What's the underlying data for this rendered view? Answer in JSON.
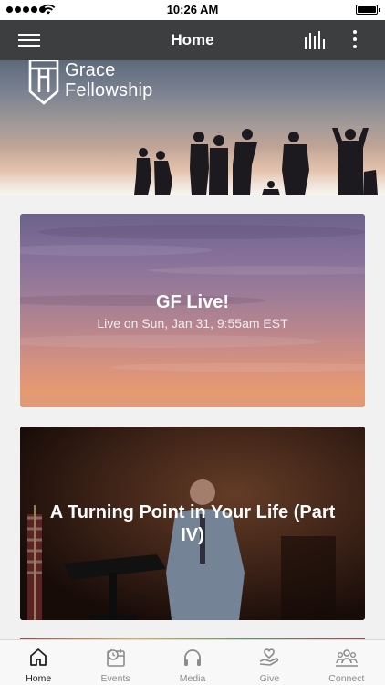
{
  "status_bar": {
    "time": "10:26 AM"
  },
  "header": {
    "title": "Home",
    "menu_icon": "hamburger-menu-icon",
    "audio_icon": "audio-bars-icon",
    "more_icon": "vertical-ellipsis-icon"
  },
  "hero": {
    "logo_line1": "Grace",
    "logo_line2": "Fellowship"
  },
  "feed": {
    "cards": [
      {
        "title": "GF Live!",
        "subtitle": "Live on Sun, Jan 31, 9:55am EST"
      },
      {
        "title": "A Turning Point in Your Life (Part IV)"
      }
    ]
  },
  "tabs": [
    {
      "label": "Home",
      "icon": "home-icon",
      "active": true
    },
    {
      "label": "Events",
      "icon": "calendar-clock-icon",
      "active": false
    },
    {
      "label": "Media",
      "icon": "headphones-icon",
      "active": false
    },
    {
      "label": "Give",
      "icon": "give-heart-hand-icon",
      "active": false
    },
    {
      "label": "Connect",
      "icon": "people-group-icon",
      "active": false
    }
  ],
  "colors": {
    "header_bg": "#3d3e40",
    "feed_bg": "#f1f1f1",
    "tab_active": "#222222",
    "tab_inactive": "#8c8c8c"
  }
}
